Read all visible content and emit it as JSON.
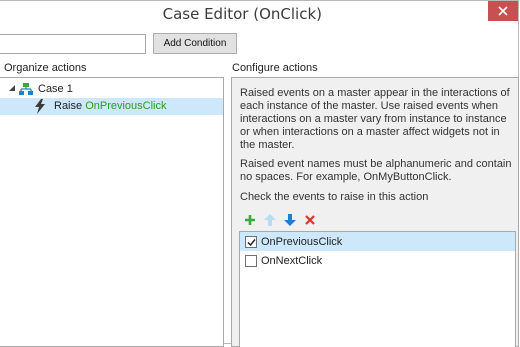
{
  "window": {
    "title": "Case Editor (OnClick)",
    "close_symbol": "✕"
  },
  "toolbar": {
    "search_value": "",
    "add_condition_label": "Add Condition"
  },
  "organize": {
    "label": "Organize actions",
    "case_label": "Case 1",
    "action_verb": "Raise",
    "action_event": "OnPreviousClick"
  },
  "configure": {
    "label": "Configure actions",
    "paragraph1": "Raised events on a master appear in the interactions of each instance of the master. Use raised events when interactions on a master vary from instance to instance or when interactions on a master affect widgets not in the master.",
    "paragraph2": "Raised event names must be alphanumeric and contain no spaces. For example, OnMyButtonClick.",
    "check_prompt": "Check the events to raise in this action",
    "icons": [
      "add-icon",
      "move-up-icon",
      "move-down-icon",
      "delete-icon"
    ],
    "events": [
      {
        "name": "OnPreviousClick",
        "checked": true,
        "selected": true
      },
      {
        "name": "OnNextClick",
        "checked": false,
        "selected": false
      }
    ]
  },
  "colors": {
    "selection": "#cde8fb",
    "close_button": "#c75050",
    "event_text_green": "#2a9d2a",
    "add_green": "#3aa83a",
    "arrow_blue": "#1e7fd4",
    "arrow_blue_disabled": "#b9dcf5",
    "delete_red": "#e0332b"
  }
}
